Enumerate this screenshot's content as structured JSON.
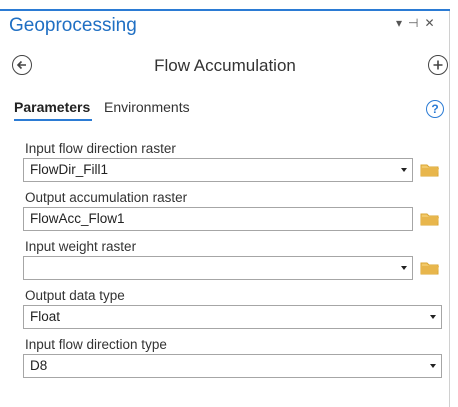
{
  "pane": {
    "title": "Geoprocessing",
    "ctrl_menu": "▾",
    "ctrl_pin": "⊣",
    "ctrl_close": "✕"
  },
  "tool": {
    "title": "Flow Accumulation"
  },
  "tabs": [
    {
      "label": "Parameters",
      "active": true
    },
    {
      "label": "Environments",
      "active": false
    }
  ],
  "help_label": "?",
  "parameters": [
    {
      "label": "Input flow direction raster",
      "value": "FlowDir_Fill1"
    },
    {
      "label": "Output accumulation raster",
      "value": "FlowAcc_Flow1"
    },
    {
      "label": "Input weight raster",
      "value": ""
    },
    {
      "label": "Output data type",
      "value": "Float"
    },
    {
      "label": "Input flow direction type",
      "value": "D8"
    }
  ],
  "colors": {
    "accent": "#2b7bd4",
    "folder": "#e8b64c"
  }
}
